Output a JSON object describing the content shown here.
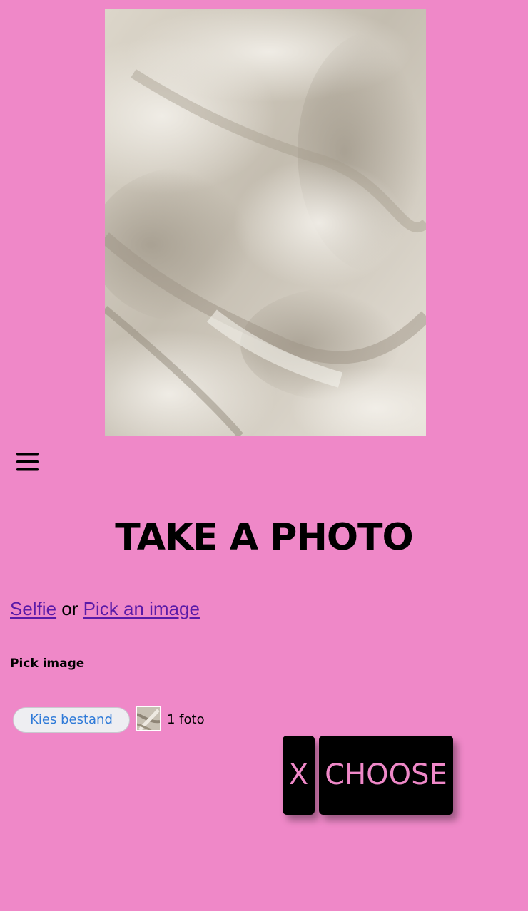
{
  "colors": {
    "background": "#ef88c8",
    "link": "#5a1aa8",
    "button_bg": "#000000",
    "button_text": "#ef88c8",
    "file_button_text": "#2f7ad8"
  },
  "menu": {
    "icon": "hamburger-menu-icon"
  },
  "title": "TAKE A PHOTO",
  "links": {
    "selfie": "Selfie",
    "separator": "or",
    "pick": "Pick an image"
  },
  "picker": {
    "label": "Pick image",
    "button_label": "Kies bestand",
    "file_count": "1 foto"
  },
  "actions": {
    "close_label": "X",
    "choose_label": "CHOOSE"
  }
}
